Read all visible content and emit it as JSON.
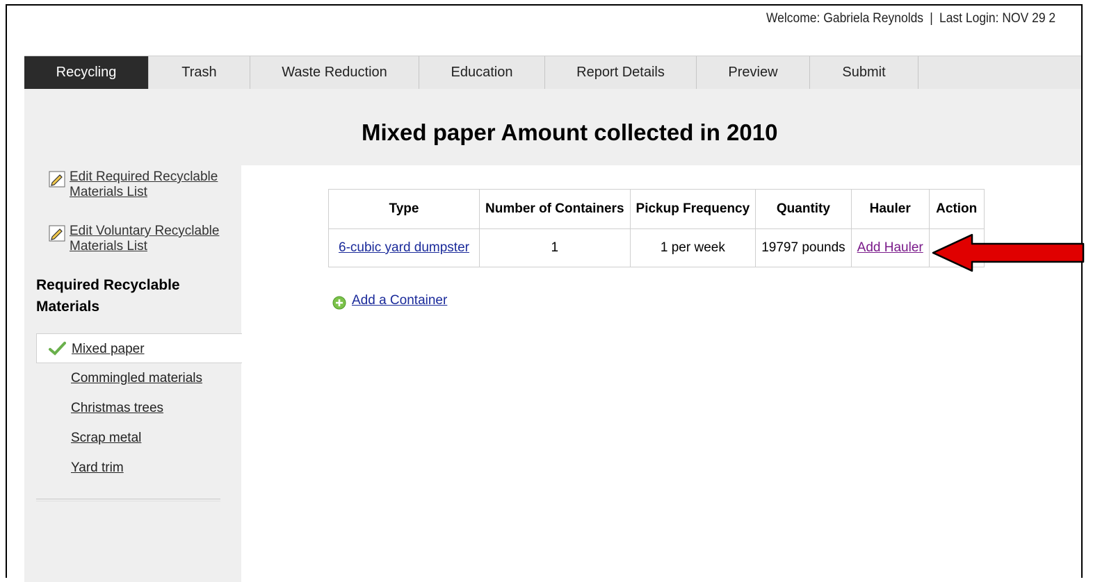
{
  "header": {
    "welcome_text": "Welcome: Gabriela Reynolds",
    "separator": "|",
    "last_login": "Last Login: NOV 29 2"
  },
  "tabs": [
    {
      "label": "Recycling",
      "active": true
    },
    {
      "label": "Trash"
    },
    {
      "label": "Waste Reduction"
    },
    {
      "label": "Education"
    },
    {
      "label": "Report Details"
    },
    {
      "label": "Preview"
    },
    {
      "label": "Submit"
    }
  ],
  "page_title": "Mixed paper  Amount collected in 2010",
  "sidebar": {
    "edit_required": "Edit Required Recyclable Materials List",
    "edit_voluntary": "Edit Voluntary Recyclable Materials List",
    "required_heading": "Required Recyclable Materials",
    "materials": [
      {
        "label": "Mixed paper",
        "selected": true
      },
      {
        "label": "Commingled materials"
      },
      {
        "label": "Christmas trees"
      },
      {
        "label": "Scrap metal"
      },
      {
        "label": "Yard trim"
      }
    ]
  },
  "table": {
    "headers": [
      "Type",
      "Number of Containers",
      "Pickup Frequency",
      "Quantity",
      "Hauler",
      "Action"
    ],
    "rows": [
      {
        "type": "6-cubic yard dumpster",
        "containers": "1",
        "frequency": "1 per week",
        "quantity": "19797 pounds",
        "hauler": "Add Hauler",
        "action": ""
      }
    ]
  },
  "add_container_label": "Add a Container",
  "colors": {
    "active_tab_bg": "#2b2b2b",
    "tab_bar_bg": "#e8e8e8",
    "sidebar_bg": "#efefef",
    "link_blue": "#1a2a9a",
    "link_visited": "#7a1a8a",
    "arrow_red": "#e00000",
    "check_green": "#6ab04c"
  },
  "icons": {
    "edit": "pencil-edit-icon",
    "selected": "checkmark-icon",
    "add": "plus-circle-icon",
    "annotation": "red-arrow-icon"
  }
}
